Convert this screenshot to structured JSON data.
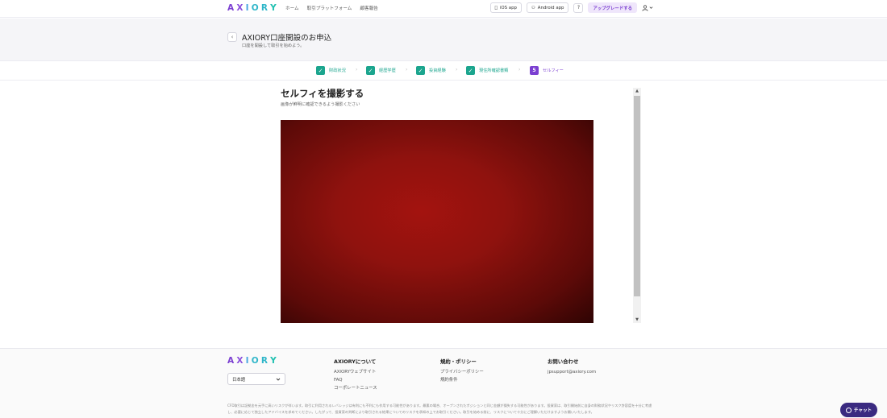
{
  "brand": {
    "logo_letters": [
      "A",
      "X",
      "I",
      "O",
      "R",
      "Y"
    ],
    "logo_colors": [
      "#7b3fd1",
      "#8a4fdc",
      "#4aa6e0",
      "#2fb6c9",
      "#2fb6c9",
      "#1fc0b0"
    ]
  },
  "nav": {
    "links": [
      "ホーム",
      "取引プラットフォーム",
      "顧客報告"
    ],
    "ios_label": "iOS app",
    "android_label": "Android app",
    "help_icon": "?",
    "upgrade_label": "アップグレードする",
    "user_icon": "user-icon"
  },
  "header": {
    "back_icon": "‹",
    "title": "AXIORY口座開設のお申込",
    "subtitle": "口座を開設して取引を始めよう。"
  },
  "stepper": {
    "steps": [
      {
        "label": "財政状況",
        "state": "done",
        "mark": "✓"
      },
      {
        "label": "経歴学歴",
        "state": "done",
        "mark": "✓"
      },
      {
        "label": "投資経験",
        "state": "done",
        "mark": "✓"
      },
      {
        "label": "現住所確認書類",
        "state": "done",
        "mark": "✓"
      },
      {
        "label": "セルフィー",
        "state": "active",
        "mark": "5"
      }
    ],
    "separator": "›",
    "done_color": "#1ba58e",
    "active_color": "#7b3fd1"
  },
  "main": {
    "title": "セルフィを撮影する",
    "subtitle": "画像が鮮明に確認できるよう撮影ください"
  },
  "footer": {
    "language": "日本語",
    "columns": [
      {
        "heading": "AXIORYについて",
        "links": [
          "AXIORYウェブサイト",
          "FAQ",
          "コーポレートニュース"
        ]
      },
      {
        "heading": "規約・ポリシー",
        "links": [
          "プライバシーポリシー",
          "規約条件"
        ]
      },
      {
        "heading": "お問い合わせ",
        "links": [
          "jpsupport@axiory.com"
        ]
      }
    ],
    "disclaimer": "CFD取引は証拠金を元手に高いリスクが伴います。取引に利用されるレバレッジは有利にも不利にも作用する可能性があります。最悪の場合、オープンされたポジションと同じ金額が損失する可能性があります。投資家は、取引開始前に自身の財務状況やリスク許容度を十分に考慮し、必要に応じて独立したアドバイスを求めてください。したがって、投資家の判断により取引される結果についてのリスクを承知の上でお取引ください。取引を始める前に、リスクについて十分にご理解いただけますようお願いいたします。"
  },
  "chat": {
    "label": "チャット"
  }
}
